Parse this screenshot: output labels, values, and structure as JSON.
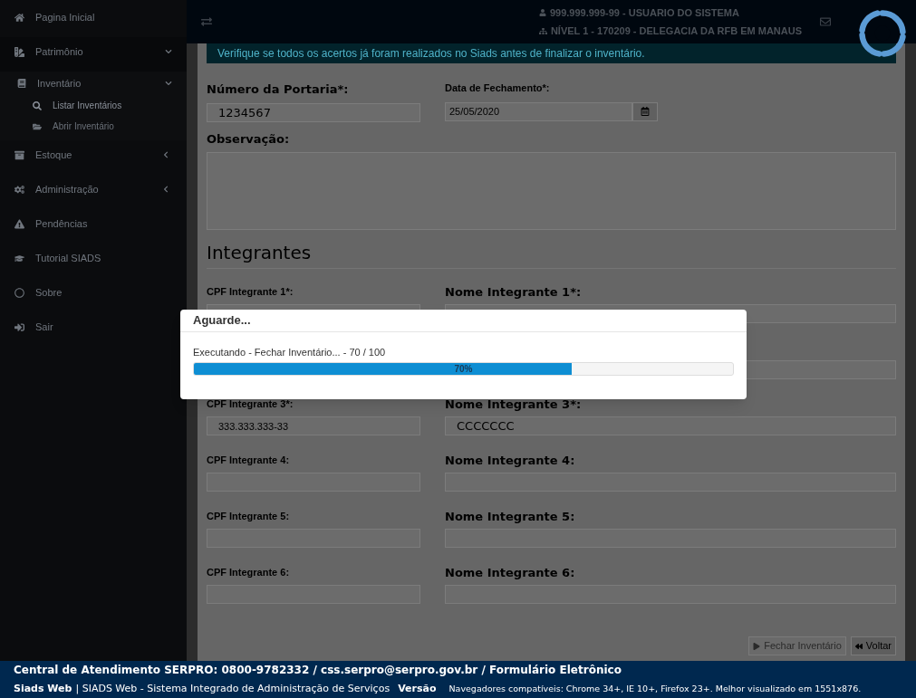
{
  "sidebar": {
    "items": [
      {
        "kind": "home",
        "label": "Pagina Inicial"
      },
      {
        "kind": "books",
        "label": "Patrimônio",
        "expanded": true,
        "children": [
          {
            "kind": "book",
            "label": "Inventário",
            "expanded": true,
            "children": [
              {
                "kind": "search",
                "label": "Listar Inventários",
                "selected": true
              },
              {
                "kind": "folder",
                "label": "Abrir Inventário",
                "selected": false
              }
            ]
          }
        ]
      },
      {
        "kind": "archive",
        "label": "Estoque",
        "expanded": false
      },
      {
        "kind": "gears",
        "label": "Administração",
        "expanded": false
      },
      {
        "kind": "warning",
        "label": "Pendências"
      },
      {
        "kind": "cap",
        "label": "Tutorial SIADS"
      },
      {
        "kind": "circle",
        "label": "Sobre"
      },
      {
        "kind": "exit",
        "label": "Sair"
      }
    ]
  },
  "header": {
    "user": "999.999.999-99 - USUARIO DO SISTEMA",
    "unit": "NÍVEL 1 - 170209 - DELEGACIA DA RFB EM MANAUS"
  },
  "alert": "Verifique se todos os acertos já foram realizados no Siads antes de finalizar o inventário.",
  "form": {
    "portaria": {
      "label": "Número da Portaria*:",
      "value": "1234567"
    },
    "fechamento": {
      "label": "Data de Fechamento*:",
      "value": "25/05/2020"
    },
    "observacao": {
      "label": "Observação:"
    },
    "section_title": "Integrantes",
    "integrantes": [
      {
        "kind": "row",
        "cpf_label": "CPF Integrante 1*:",
        "nome_label": "Nome Integrante 1*:"
      },
      {
        "kind": "covered"
      },
      {
        "kind": "row",
        "cpf_label": "CPF Integrante 3*:",
        "nome_label": "Nome Integrante 3*:",
        "cpf": "333.333.333-33",
        "nome": "CCCCCCC"
      },
      {
        "kind": "row",
        "cpf_label": "CPF Integrante 4:",
        "nome_label": "Nome Integrante 4:"
      },
      {
        "kind": "row",
        "cpf_label": "CPF Integrante 5:",
        "nome_label": "Nome Integrante 5:"
      },
      {
        "kind": "row",
        "cpf_label": "CPF Integrante 6:",
        "nome_label": "Nome Integrante 6:"
      }
    ]
  },
  "buttons": [
    {
      "kind": "play",
      "label": "Fechar Inventário",
      "disabled": true
    },
    {
      "kind": "back",
      "label": "Voltar",
      "disabled": false
    }
  ],
  "modal": {
    "title": "Aguarde...",
    "message": "Executando - Fechar Inventário... - 70 / 100",
    "level": 0.7,
    "reading": "70%"
  },
  "footer": {
    "contact": "Central de Atendimento SERPRO: 0800-9782332 / css.serpro@serpro.gov.br / Formulário Eletrônico",
    "app": "Siads Web",
    "description": "| SIADS Web - Sistema Integrado de Administração de Serviços",
    "version": "Versão",
    "browsers": "Navegadores compatíveis: Chrome 34+, IE 10+, Firefox 23+. Melhor visualizado em 1551x876."
  }
}
